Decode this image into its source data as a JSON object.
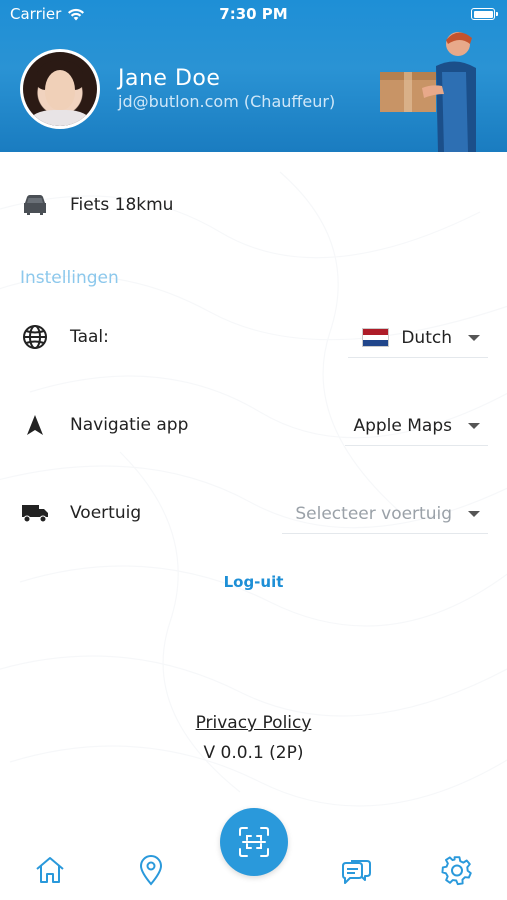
{
  "status_bar": {
    "carrier": "Carrier",
    "time": "7:30 PM"
  },
  "profile": {
    "name": "Jane Doe",
    "email_role": "jd@butlon.com (Chauffeur)"
  },
  "vehicle": {
    "icon": "car-icon",
    "label": "Fiets 18kmu"
  },
  "settings": {
    "section_title": "Instellingen",
    "language": {
      "icon": "globe-icon",
      "label": "Taal:",
      "value": "Dutch",
      "flag": "netherlands-flag"
    },
    "navigation": {
      "icon": "navigation-arrow-icon",
      "label": "Navigatie app",
      "value": "Apple Maps"
    },
    "vehicle_select": {
      "icon": "truck-icon",
      "label": "Voertuig",
      "placeholder": "Selecteer voertuig"
    }
  },
  "actions": {
    "logout": "Log-uit",
    "privacy": "Privacy Policy",
    "version": "V 0.0.1 (2P)"
  },
  "nav": {
    "items": [
      "home-icon",
      "location-pin-icon",
      "scan-icon",
      "chat-icon",
      "settings-gear-icon"
    ]
  },
  "colors": {
    "primary": "#1e8fd6",
    "section_title": "#8cc8ec",
    "placeholder": "#9aa1a8"
  }
}
